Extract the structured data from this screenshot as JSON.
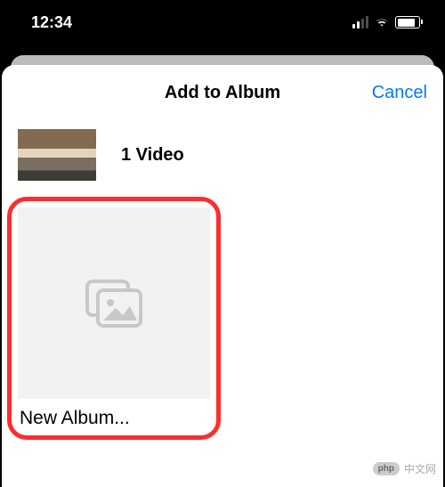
{
  "status": {
    "time": "12:34"
  },
  "sheet": {
    "title": "Add to Album",
    "cancel_label": "Cancel"
  },
  "selection": {
    "count_label": "1 Video"
  },
  "albums": {
    "new_label": "New Album..."
  },
  "watermark": {
    "badge": "php",
    "text": "中文网"
  }
}
